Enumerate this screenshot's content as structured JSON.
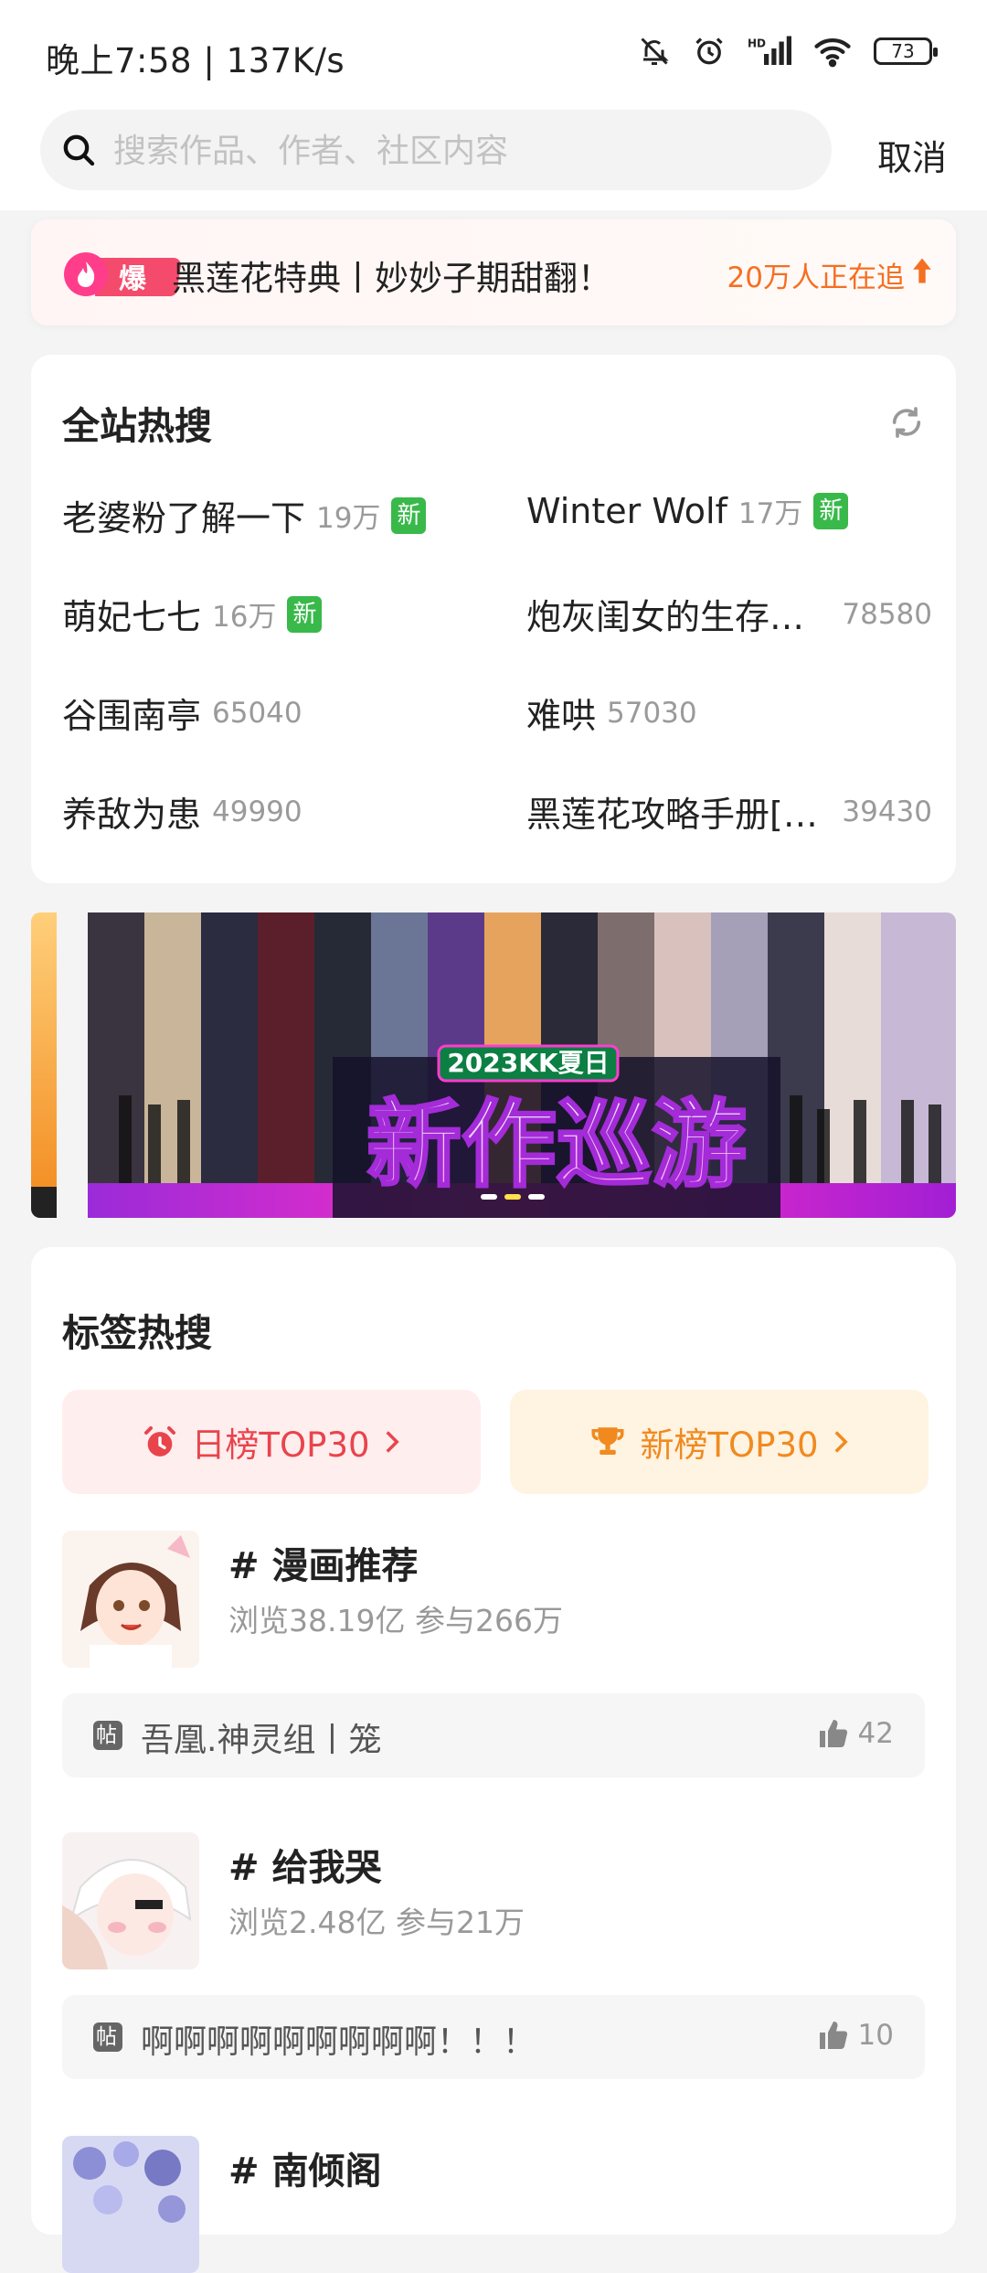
{
  "status_bar": {
    "time": "晚上7:58 | 137K/s",
    "battery": "73"
  },
  "search": {
    "placeholder": "搜索作品、作者、社区内容",
    "cancel_label": "取消"
  },
  "trending_banner": {
    "badge_label": "爆",
    "text": "黑莲花特典丨妙妙子期甜翻！",
    "count": "20万人正在追"
  },
  "hot_search": {
    "title": "全站热搜",
    "new_label": "新",
    "items": [
      {
        "name": "老婆粉了解一下",
        "count": "19万",
        "is_new": true
      },
      {
        "name": "Winter Wolf",
        "count": "17万",
        "is_new": true
      },
      {
        "name": "萌妃七七",
        "count": "16万",
        "is_new": true
      },
      {
        "name": "炮灰闺女的生存…",
        "count": "78580",
        "is_new": false
      },
      {
        "name": "谷围南亭",
        "count": "65040",
        "is_new": false
      },
      {
        "name": "难哄",
        "count": "57030",
        "is_new": false
      },
      {
        "name": "养敌为患",
        "count": "49990",
        "is_new": false
      },
      {
        "name": "黑莲花攻略手册[…",
        "count": "39430",
        "is_new": false
      }
    ]
  },
  "promo_banner": {
    "year_label": "2023KK夏日",
    "title": "新作巡游"
  },
  "tag_hot_search": {
    "title": "标签热搜",
    "daily_rank_label": "日榜TOP30",
    "new_rank_label": "新榜TOP30",
    "topics": [
      {
        "title": "# 漫画推荐",
        "stats": "浏览38.19亿 参与266万",
        "post_badge": "帖",
        "post_text": "吾凰.神灵组丨笼",
        "likes": "42"
      },
      {
        "title": "# 给我哭",
        "stats": "浏览2.48亿 参与21万",
        "post_badge": "帖",
        "post_text": "啊啊啊啊啊啊啊啊啊！！！",
        "likes": "10"
      },
      {
        "title": "# 南倾阁"
      }
    ]
  },
  "colors": {
    "accent_orange": "#f56f21",
    "new_green": "#39b94a",
    "daily_red": "#e9444c",
    "new_rank_orange": "#f08a1f"
  }
}
